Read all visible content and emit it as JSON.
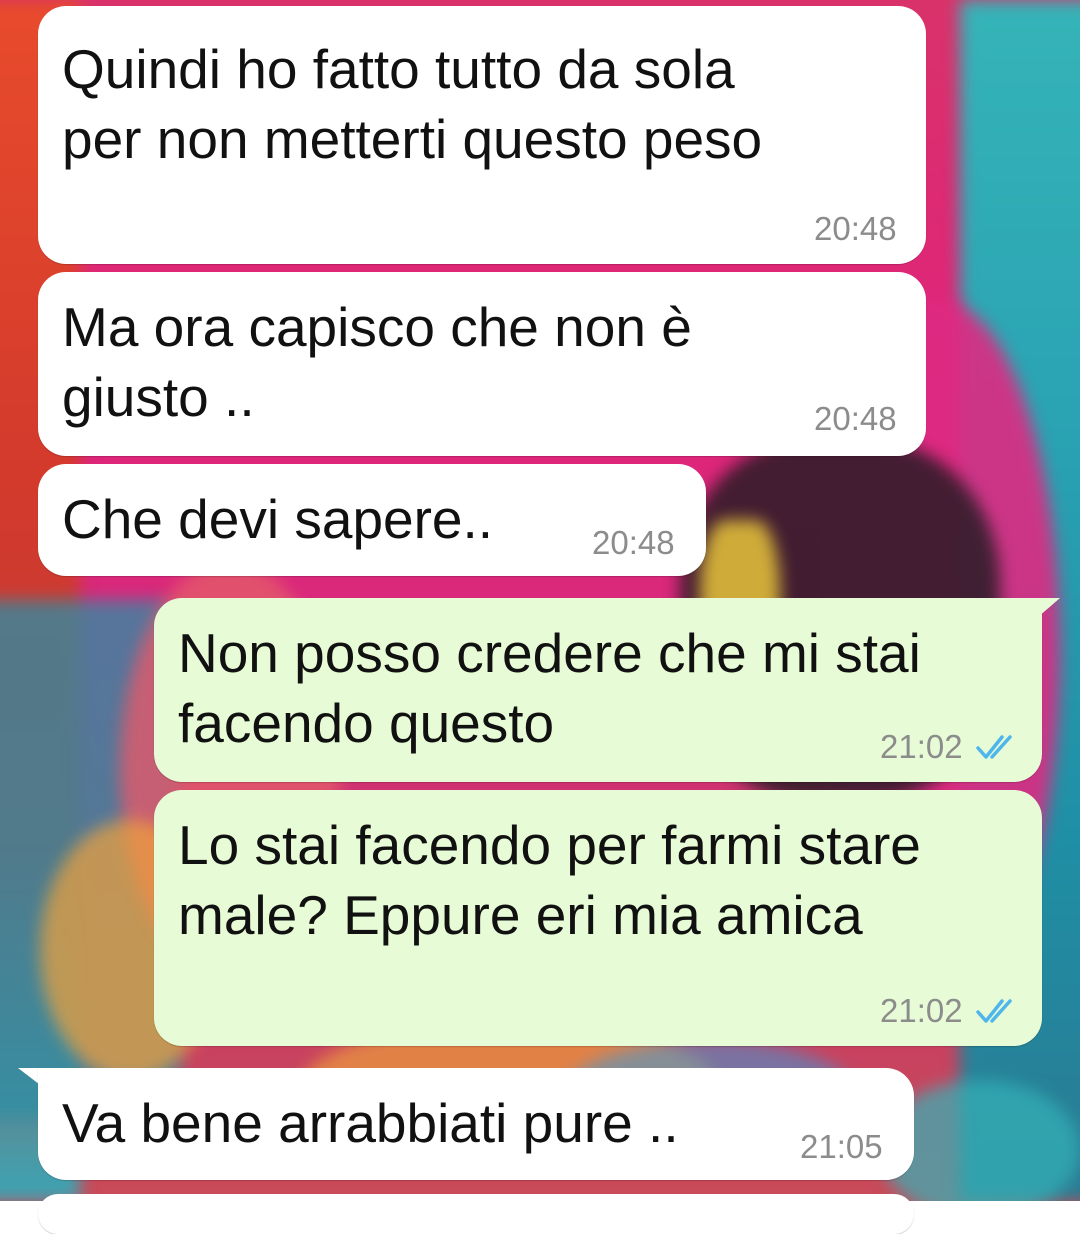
{
  "chat": {
    "messages": [
      {
        "direction": "in",
        "text": "Quindi ho fatto tutto da sola\nper non metterti questo peso",
        "time": "20:48"
      },
      {
        "direction": "in",
        "text": "Ma ora capisco che non è\ngiusto ..",
        "time": "20:48"
      },
      {
        "direction": "in",
        "text": "Che devi sapere..",
        "time": "20:48"
      },
      {
        "direction": "out",
        "text": "Non posso credere che mi stai\nfacendo questo",
        "time": "21:02",
        "status": "read"
      },
      {
        "direction": "out",
        "text": "Lo stai facendo per farmi stare\nmale? Eppure eri mia amica",
        "time": "21:02",
        "status": "read"
      },
      {
        "direction": "in",
        "text": "Va bene arrabbiati pure ..",
        "time": "21:05"
      }
    ]
  },
  "colors": {
    "incoming_bubble": "#ffffff",
    "outgoing_bubble": "#e7fcd6",
    "read_ticks": "#4fb6ec",
    "timestamp": "#8c8c8c"
  },
  "icons": {
    "read_status": "double-check-icon"
  }
}
